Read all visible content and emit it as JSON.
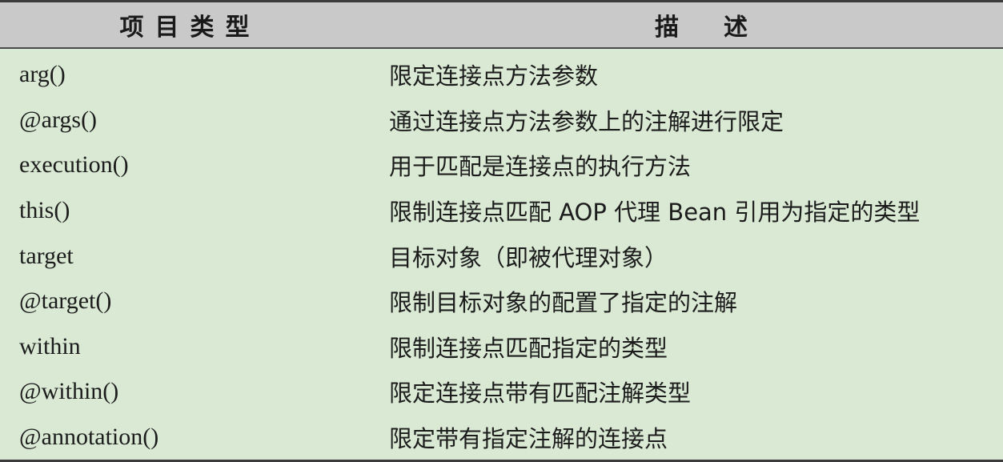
{
  "table": {
    "headers": {
      "type": "项目类型",
      "description": "描述"
    },
    "rows": [
      {
        "type": "arg()",
        "description": "限定连接点方法参数"
      },
      {
        "type": "@args()",
        "description": "通过连接点方法参数上的注解进行限定"
      },
      {
        "type": "execution()",
        "description": "用于匹配是连接点的执行方法"
      },
      {
        "type": "this()",
        "description": "限制连接点匹配 AOP 代理 Bean 引用为指定的类型"
      },
      {
        "type": "target",
        "description": "目标对象（即被代理对象）"
      },
      {
        "type": "@target()",
        "description": "限制目标对象的配置了指定的注解"
      },
      {
        "type": "within",
        "description": "限制连接点匹配指定的类型"
      },
      {
        "type": "@within()",
        "description": "限定连接点带有匹配注解类型"
      },
      {
        "type": "@annotation()",
        "description": "限定带有指定注解的连接点"
      }
    ]
  }
}
